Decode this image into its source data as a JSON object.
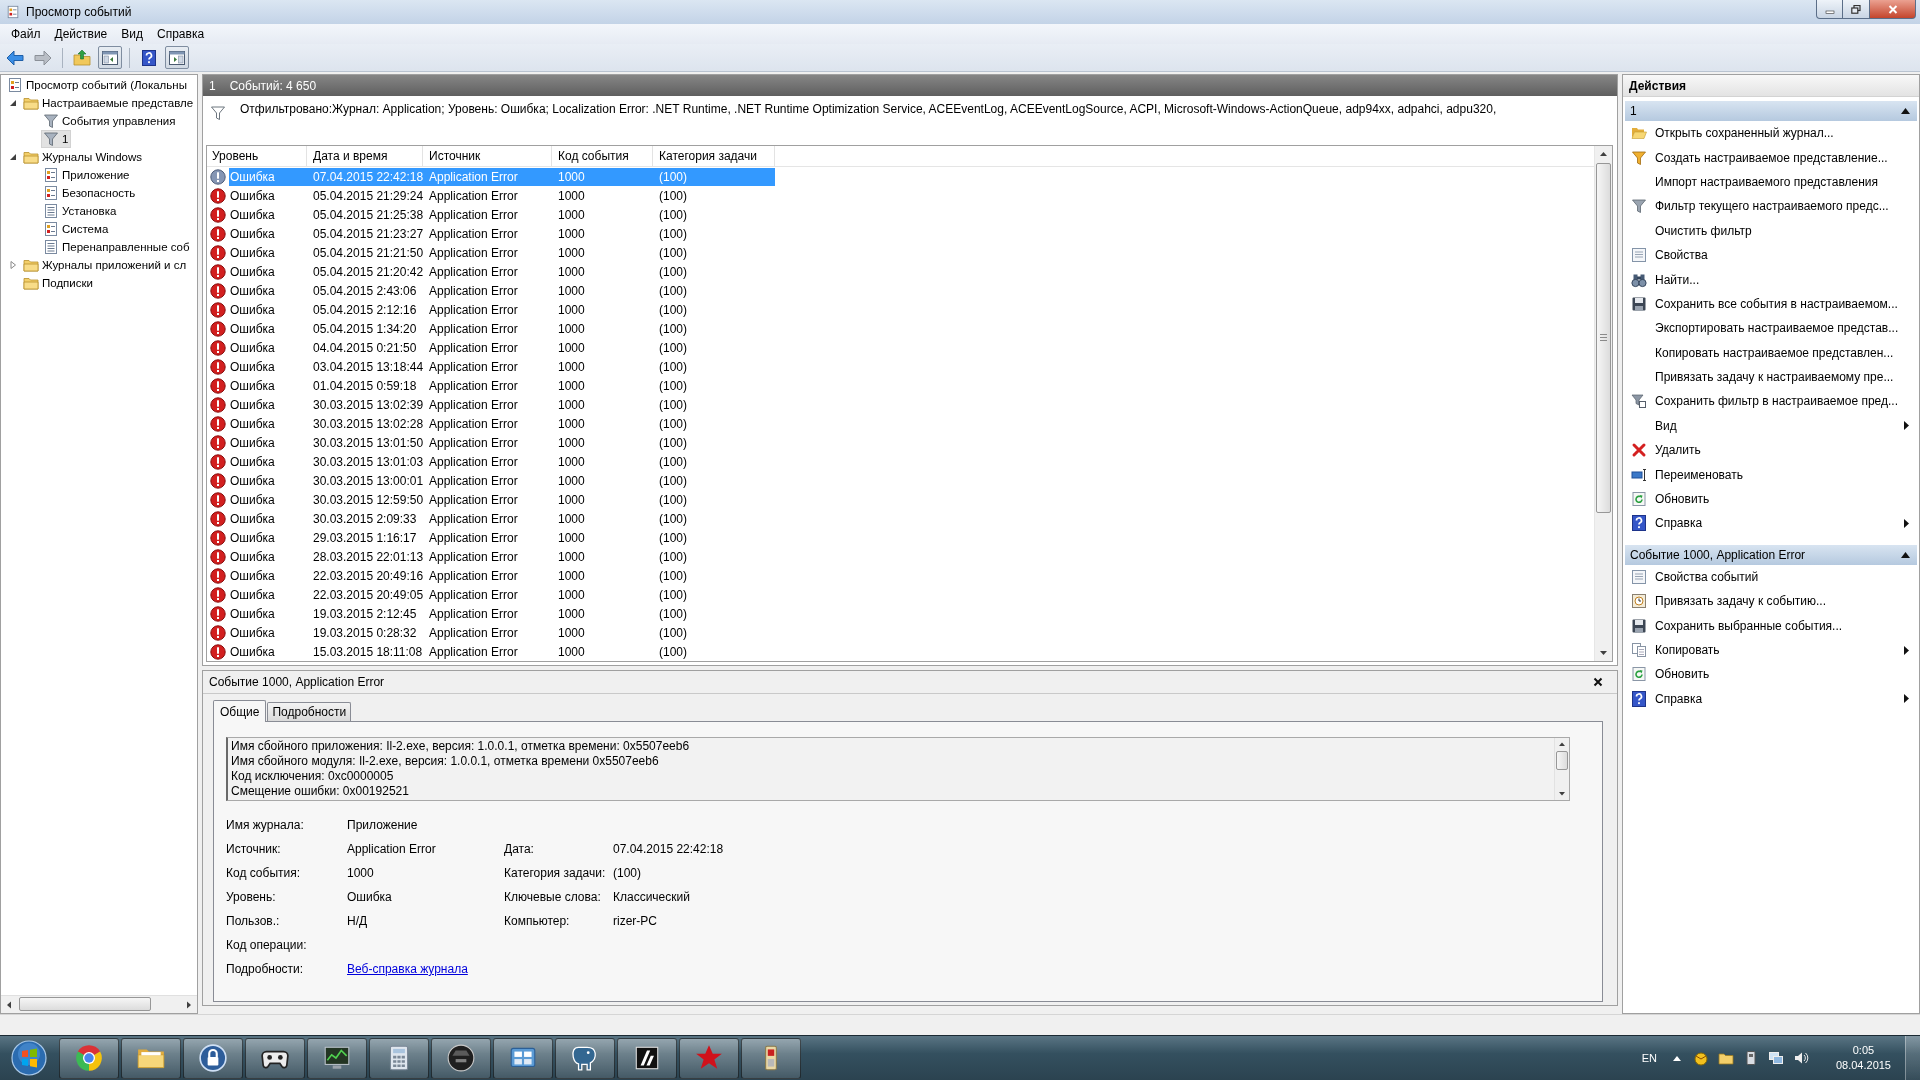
{
  "window": {
    "title": "Просмотр событий"
  },
  "menu": [
    {
      "label": "Файл"
    },
    {
      "label": "Действие"
    },
    {
      "label": "Вид"
    },
    {
      "label": "Справка"
    }
  ],
  "toolbar": {
    "groups": [
      {
        "buttons": [
          {
            "kind": "back",
            "disabled": false,
            "pressed": false
          },
          {
            "kind": "forward",
            "disabled": true,
            "pressed": false
          }
        ]
      },
      {
        "buttons": [
          {
            "kind": "up",
            "pressed": false
          },
          {
            "kind": "tree",
            "pressed": true
          }
        ]
      },
      {
        "buttons": [
          {
            "kind": "help",
            "pressed": false
          },
          {
            "kind": "pane",
            "pressed": true
          }
        ]
      }
    ]
  },
  "tree": [
    {
      "label": "Просмотр событий (Локальны",
      "kind": "root",
      "selected": false,
      "children": [
        {
          "label": "Настраиваемые представле",
          "kind": "folder",
          "expanded": true,
          "selected": false,
          "children": [
            {
              "label": "События управления",
              "kind": "view",
              "selected": false
            },
            {
              "label": "1",
              "kind": "view",
              "selected": true
            }
          ]
        },
        {
          "label": "Журналы Windows",
          "kind": "folder",
          "expanded": true,
          "selected": false,
          "children": [
            {
              "label": "Приложение",
              "kind": "log",
              "selected": false
            },
            {
              "label": "Безопасность",
              "kind": "log",
              "selected": false
            },
            {
              "label": "Установка",
              "kind": "list",
              "selected": false
            },
            {
              "label": "Система",
              "kind": "log",
              "selected": false
            },
            {
              "label": "Перенаправленные соб",
              "kind": "list",
              "selected": false
            }
          ]
        },
        {
          "label": "Журналы приложений и сл",
          "kind": "folder",
          "expanded": false,
          "selected": false
        },
        {
          "label": "Подписки",
          "kind": "folder",
          "selected": false
        }
      ]
    }
  ],
  "log_header": {
    "name": "1",
    "count": "Событий: 4 650"
  },
  "filter": "Отфильтровано:Журнал: Application; Уровень: Ошибка; Localization Error: .NET Runtime, .NET Runtime Optimization Service, ACEEventLog, ACEEventLogSource, ACPI, Microsoft-Windows-ActionQueue, adp94xx, adpahci, adpu320,",
  "table": {
    "columns": [
      "Уровень",
      "Дата и время",
      "Источник",
      "Код события",
      "Категория задачи"
    ],
    "rows": [
      {
        "kind": "error",
        "level": "Ошибка",
        "date": "07.04.2015 22:42:18",
        "source": "Application Error",
        "event_id": "1000",
        "category": "(100)",
        "selected": true
      },
      {
        "kind": "error",
        "level": "Ошибка",
        "date": "05.04.2015 21:29:24",
        "source": "Application Error",
        "event_id": "1000",
        "category": "(100)",
        "selected": false
      },
      {
        "kind": "error",
        "level": "Ошибка",
        "date": "05.04.2015 21:25:38",
        "source": "Application Error",
        "event_id": "1000",
        "category": "(100)",
        "selected": false
      },
      {
        "kind": "error",
        "level": "Ошибка",
        "date": "05.04.2015 21:23:27",
        "source": "Application Error",
        "event_id": "1000",
        "category": "(100)",
        "selected": false
      },
      {
        "kind": "error",
        "level": "Ошибка",
        "date": "05.04.2015 21:21:50",
        "source": "Application Error",
        "event_id": "1000",
        "category": "(100)",
        "selected": false
      },
      {
        "kind": "error",
        "level": "Ошибка",
        "date": "05.04.2015 21:20:42",
        "source": "Application Error",
        "event_id": "1000",
        "category": "(100)",
        "selected": false
      },
      {
        "kind": "error",
        "level": "Ошибка",
        "date": "05.04.2015 2:43:06",
        "source": "Application Error",
        "event_id": "1000",
        "category": "(100)",
        "selected": false
      },
      {
        "kind": "error",
        "level": "Ошибка",
        "date": "05.04.2015 2:12:16",
        "source": "Application Error",
        "event_id": "1000",
        "category": "(100)",
        "selected": false
      },
      {
        "kind": "error",
        "level": "Ошибка",
        "date": "05.04.2015 1:34:20",
        "source": "Application Error",
        "event_id": "1000",
        "category": "(100)",
        "selected": false
      },
      {
        "kind": "error",
        "level": "Ошибка",
        "date": "04.04.2015 0:21:50",
        "source": "Application Error",
        "event_id": "1000",
        "category": "(100)",
        "selected": false
      },
      {
        "kind": "error",
        "level": "Ошибка",
        "date": "03.04.2015 13:18:44",
        "source": "Application Error",
        "event_id": "1000",
        "category": "(100)",
        "selected": false
      },
      {
        "kind": "error",
        "level": "Ошибка",
        "date": "01.04.2015 0:59:18",
        "source": "Application Error",
        "event_id": "1000",
        "category": "(100)",
        "selected": false
      },
      {
        "kind": "error",
        "level": "Ошибка",
        "date": "30.03.2015 13:02:39",
        "source": "Application Error",
        "event_id": "1000",
        "category": "(100)",
        "selected": false
      },
      {
        "kind": "error",
        "level": "Ошибка",
        "date": "30.03.2015 13:02:28",
        "source": "Application Error",
        "event_id": "1000",
        "category": "(100)",
        "selected": false
      },
      {
        "kind": "error",
        "level": "Ошибка",
        "date": "30.03.2015 13:01:50",
        "source": "Application Error",
        "event_id": "1000",
        "category": "(100)",
        "selected": false
      },
      {
        "kind": "error",
        "level": "Ошибка",
        "date": "30.03.2015 13:01:03",
        "source": "Application Error",
        "event_id": "1000",
        "category": "(100)",
        "selected": false
      },
      {
        "kind": "error",
        "level": "Ошибка",
        "date": "30.03.2015 13:00:01",
        "source": "Application Error",
        "event_id": "1000",
        "category": "(100)",
        "selected": false
      },
      {
        "kind": "error",
        "level": "Ошибка",
        "date": "30.03.2015 12:59:50",
        "source": "Application Error",
        "event_id": "1000",
        "category": "(100)",
        "selected": false
      },
      {
        "kind": "error",
        "level": "Ошибка",
        "date": "30.03.2015 2:09:33",
        "source": "Application Error",
        "event_id": "1000",
        "category": "(100)",
        "selected": false
      },
      {
        "kind": "error",
        "level": "Ошибка",
        "date": "29.03.2015 1:16:17",
        "source": "Application Error",
        "event_id": "1000",
        "category": "(100)",
        "selected": false
      },
      {
        "kind": "error",
        "level": "Ошибка",
        "date": "28.03.2015 22:01:13",
        "source": "Application Error",
        "event_id": "1000",
        "category": "(100)",
        "selected": false
      },
      {
        "kind": "error",
        "level": "Ошибка",
        "date": "22.03.2015 20:49:16",
        "source": "Application Error",
        "event_id": "1000",
        "category": "(100)",
        "selected": false
      },
      {
        "kind": "error",
        "level": "Ошибка",
        "date": "22.03.2015 20:49:05",
        "source": "Application Error",
        "event_id": "1000",
        "category": "(100)",
        "selected": false
      },
      {
        "kind": "error",
        "level": "Ошибка",
        "date": "19.03.2015 2:12:45",
        "source": "Application Error",
        "event_id": "1000",
        "category": "(100)",
        "selected": false
      },
      {
        "kind": "error",
        "level": "Ошибка",
        "date": "19.03.2015 0:28:32",
        "source": "Application Error",
        "event_id": "1000",
        "category": "(100)",
        "selected": false
      },
      {
        "kind": "error",
        "level": "Ошибка",
        "date": "15.03.2015 18:11:08",
        "source": "Application Error",
        "event_id": "1000",
        "category": "(100)",
        "selected": false
      }
    ]
  },
  "details": {
    "title": "Событие 1000, Application Error",
    "tabs": [
      {
        "label": "Общие",
        "selected": true
      },
      {
        "label": "Подробности",
        "selected": false
      }
    ],
    "description": [
      "Имя сбойного приложения: Il-2.exe, версия: 1.0.0.1, отметка времени: 0x5507eeb6",
      "Имя сбойного модуля: Il-2.exe, версия: 1.0.0.1, отметка времени 0x5507eeb6",
      "Код исключения: 0xc0000005",
      "Смещение ошибки: 0x00192521"
    ],
    "fields": [
      {
        "label": "Имя журнала:",
        "value": "Приложение"
      },
      {
        "label": "Источник:",
        "value": "Application Error",
        "label_2": "Дата:",
        "value_2": "07.04.2015 22:42:18"
      },
      {
        "label": "Код события:",
        "value": "1000",
        "label_2": "Категория задачи:",
        "value_2": "(100)"
      },
      {
        "label": "Уровень:",
        "value": "Ошибка",
        "label_2": "Ключевые слова:",
        "value_2": "Классический"
      },
      {
        "label": "Пользов.:",
        "value": "Н/Д",
        "label_2": "Компьютер:",
        "value_2": "rizer-PC"
      },
      {
        "label": "Код операции:"
      },
      {
        "label": "Подробности:",
        "link": "Веб-справка журнала"
      }
    ]
  },
  "actions": {
    "title": "Действия",
    "sections": [
      {
        "title": "1",
        "expanded": true,
        "items": [
          {
            "label": "Открыть сохраненный журнал...",
            "kind": "open",
            "submenu": false
          },
          {
            "label": "Создать настраиваемое представление...",
            "kind": "create",
            "submenu": false
          },
          {
            "label": "Импорт настраиваемого представления",
            "kind": "none",
            "submenu": false
          },
          {
            "label": "Фильтр текущего настраиваемого предс...",
            "kind": "filter",
            "submenu": false
          },
          {
            "label": "Очистить фильтр",
            "kind": "none",
            "submenu": false
          },
          {
            "label": "Свойства",
            "kind": "properties",
            "submenu": false
          },
          {
            "label": "Найти...",
            "kind": "find",
            "submenu": false
          },
          {
            "label": "Сохранить все события в настраиваемом...",
            "kind": "save",
            "submenu": false
          },
          {
            "label": "Экспортировать настраиваемое представ...",
            "kind": "none",
            "submenu": false
          },
          {
            "label": "Копировать настраиваемое представлен...",
            "kind": "none",
            "submenu": false
          },
          {
            "label": "Привязать задачу к настраиваемому пре...",
            "kind": "none",
            "submenu": false
          },
          {
            "label": "Сохранить фильтр в настраиваемое пред...",
            "kind": "savefilter",
            "submenu": false
          },
          {
            "label": "Вид",
            "kind": "none",
            "submenu": true
          },
          {
            "label": "Удалить",
            "kind": "delete",
            "submenu": false
          },
          {
            "label": "Переименовать",
            "kind": "rename",
            "submenu": false
          },
          {
            "label": "Обновить",
            "kind": "refresh",
            "submenu": false
          },
          {
            "label": "Справка",
            "kind": "help",
            "submenu": true
          }
        ]
      },
      {
        "title": "Событие 1000, Application Error",
        "expanded": true,
        "items": [
          {
            "label": "Свойства событий",
            "kind": "properties",
            "submenu": false
          },
          {
            "label": "Привязать задачу к событию...",
            "kind": "task",
            "submenu": false
          },
          {
            "label": "Сохранить выбранные события...",
            "kind": "save",
            "submenu": false
          },
          {
            "label": "Копировать",
            "kind": "copy",
            "submenu": true
          },
          {
            "label": "Обновить",
            "kind": "refresh",
            "submenu": false
          },
          {
            "label": "Справка",
            "kind": "help",
            "submenu": true
          }
        ]
      }
    ]
  },
  "taskbar": {
    "language": "EN",
    "time": "0:05",
    "date": "08.04.2015"
  }
}
